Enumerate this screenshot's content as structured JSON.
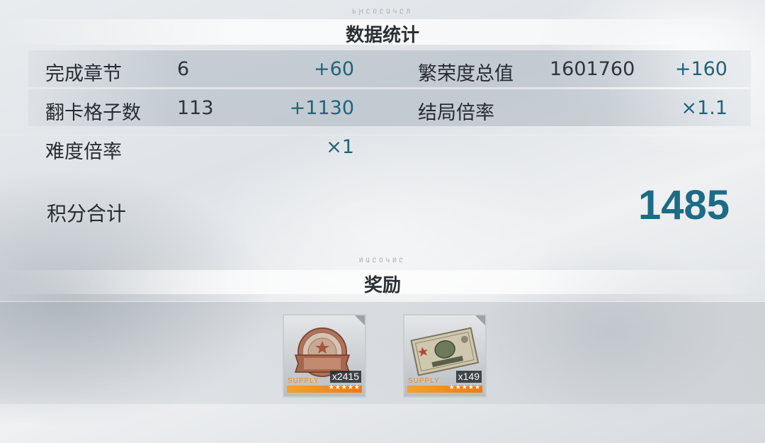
{
  "stats_section": {
    "deco_text": "ЬԨԸОԸԱԿԸЛ",
    "title": "数据统计"
  },
  "stats": {
    "chapters_completed": {
      "label": "完成章节",
      "value": "6",
      "bonus": "+60"
    },
    "prosperity_total": {
      "label": "繁荣度总值",
      "value": "1601760",
      "bonus": "+160"
    },
    "cards_flipped": {
      "label": "翻卡格子数",
      "value": "113",
      "bonus": "+1130"
    },
    "ending_multiplier": {
      "label": "结局倍率",
      "value": "",
      "bonus": "×1.1"
    },
    "difficulty_multiplier": {
      "label": "难度倍率",
      "value": "",
      "bonus": "×1"
    }
  },
  "total": {
    "label": "积分合计",
    "value": "1485"
  },
  "reward_section": {
    "deco_text": "ИԱԸОԿИԸ",
    "title": "奖励"
  },
  "rewards": [
    {
      "item_icon": "bronze-medal-icon",
      "quantity": "x2415",
      "supply_text": "SUPPLY",
      "stars": "★★★★★"
    },
    {
      "item_icon": "banknote-icon",
      "quantity": "x149",
      "supply_text": "SUPPLY",
      "stars": "★★★★★"
    }
  ],
  "colors": {
    "accent_teal": "#1d6b84",
    "bonus_teal": "#20637a",
    "supply_orange": "#f08a1a"
  }
}
